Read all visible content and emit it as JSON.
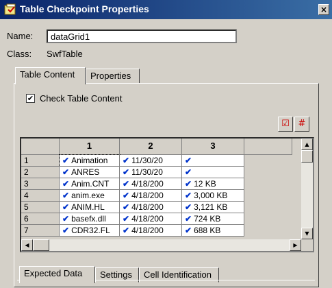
{
  "window": {
    "title": "Table Checkpoint Properties",
    "close_glyph": "×"
  },
  "name_label": "Name:",
  "name_value": "dataGrid1",
  "class_label": "Class:",
  "class_value": "SwfTable",
  "tabs": [
    "Table Content",
    "Properties"
  ],
  "check_table_content": {
    "label": "Check Table Content",
    "checked": true
  },
  "grid": {
    "columns": [
      "1",
      "2",
      "3"
    ],
    "rows": [
      {
        "num": "1",
        "cells": [
          "Animation",
          "11/30/20",
          ""
        ]
      },
      {
        "num": "2",
        "cells": [
          "ANRES",
          "11/30/20",
          ""
        ]
      },
      {
        "num": "3",
        "cells": [
          "Anim.CNT",
          "4/18/200",
          "12 KB"
        ]
      },
      {
        "num": "4",
        "cells": [
          "anim.exe",
          "4/18/200",
          "3,000 KB"
        ]
      },
      {
        "num": "5",
        "cells": [
          "ANIM.HL",
          "4/18/200",
          "3,121 KB"
        ]
      },
      {
        "num": "6",
        "cells": [
          "basefx.dll",
          "4/18/200",
          "724 KB"
        ]
      },
      {
        "num": "7",
        "cells": [
          "CDR32.FL",
          "4/18/200",
          "688 KB"
        ]
      }
    ]
  },
  "bottom_tabs": [
    "Expected Data",
    "Settings",
    "Cell Identification"
  ]
}
